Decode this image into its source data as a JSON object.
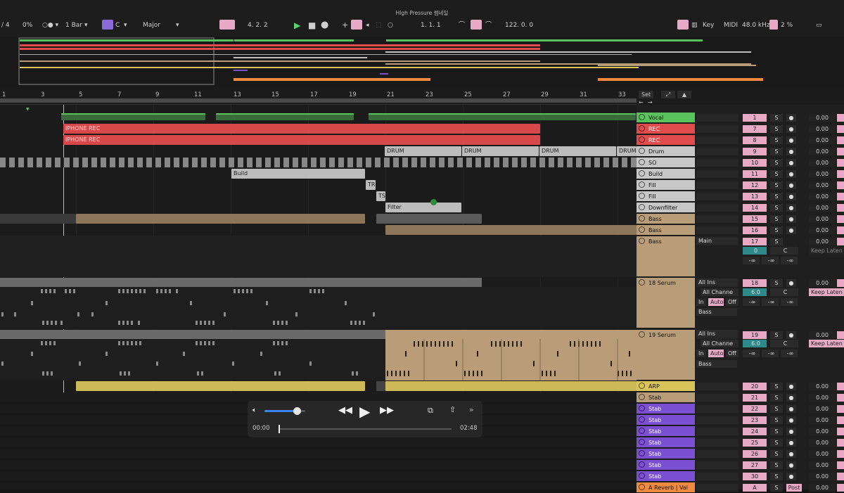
{
  "window": {
    "title": "High Pressure 썸네일"
  },
  "toolbar": {
    "time_sig": "/ 4",
    "cpu": "0%",
    "quantize": "1 Bar",
    "scale_root": "C",
    "scale_mode": "Major",
    "position": "4.  2.  2",
    "loop_start": "1.  1.  1",
    "tempo": "122.  0.  0",
    "key_label": "Key",
    "midi_label": "MIDI",
    "sample_rate": "48.0 kHz",
    "cpu_load": "2 %"
  },
  "ruler": {
    "bars": [
      "1",
      "3",
      "5",
      "7",
      "9",
      "11",
      "13",
      "15",
      "17",
      "19",
      "21",
      "23",
      "25",
      "27",
      "29",
      "31",
      "33"
    ]
  },
  "set_label": "Set",
  "clips": {
    "rec1": "IPHONE REC",
    "rec2": "IPHONE REC",
    "drum1": "DRUM",
    "drum2": "DRUM",
    "drum3": "DRUM",
    "drum4": "DRUM",
    "build": "Build",
    "tr": "TR",
    "ts": "TS",
    "filter": "Filter"
  },
  "tracks": [
    {
      "name": "Vocal",
      "num": "1",
      "color": "#59c25a"
    },
    {
      "name": "REC",
      "num": "7",
      "color": "#e04b4b"
    },
    {
      "name": "REC",
      "num": "8",
      "color": "#e04b4b"
    },
    {
      "name": "Drum",
      "num": "9",
      "color": "#c7c7c7"
    },
    {
      "name": "SO",
      "num": "10",
      "color": "#c7c7c7"
    },
    {
      "name": "Build",
      "num": "11",
      "color": "#c7c7c7"
    },
    {
      "name": "Fill",
      "num": "12",
      "color": "#c7c7c7"
    },
    {
      "name": "Fill",
      "num": "13",
      "color": "#c7c7c7"
    },
    {
      "name": "Downfilter",
      "num": "14",
      "color": "#c7c7c7"
    },
    {
      "name": "Bass",
      "num": "15",
      "color": "#b89d78"
    },
    {
      "name": "Bass",
      "num": "16",
      "color": "#b89d78"
    },
    {
      "name": "Bass",
      "num": "17",
      "color": "#b89d78"
    },
    {
      "name": "18 Serum",
      "num": "18",
      "color": "#b89d78"
    },
    {
      "name": "19 Serum",
      "num": "19",
      "color": "#b89d78"
    },
    {
      "name": "ARP",
      "num": "20",
      "color": "#d9c45a"
    },
    {
      "name": "Stab",
      "num": "21",
      "color": "#b89d78"
    },
    {
      "name": "Stab",
      "num": "22",
      "color": "#7a4fd1"
    },
    {
      "name": "Stab",
      "num": "23",
      "color": "#7a4fd1"
    },
    {
      "name": "Stab",
      "num": "24",
      "color": "#7a4fd1"
    },
    {
      "name": "Stab",
      "num": "25",
      "color": "#7a4fd1"
    },
    {
      "name": "Stab",
      "num": "26",
      "color": "#7a4fd1"
    },
    {
      "name": "Stab",
      "num": "27",
      "color": "#7a4fd1"
    },
    {
      "name": "Stab",
      "num": "30",
      "color": "#7a4fd1"
    },
    {
      "name": "A Reverb | Val",
      "num": "A",
      "color": "#f08a3e"
    }
  ],
  "mixer": {
    "solo": "S",
    "volume": "0.00",
    "post": "Post",
    "bass17_route": "Main",
    "bass17_pan": "0",
    "bass17_center": "C",
    "inf": "-∞",
    "keep_latency": "Keep Laten",
    "serum18_in": "All Ins",
    "serum18_ch": "All Channe",
    "serum18_pan": "6.0",
    "serum19_in": "All Ins",
    "serum19_ch": "All Channe",
    "serum19_pan": "6.0",
    "mon_in": "In",
    "mon_auto": "Auto",
    "mon_off": "Off",
    "route_bass": "Bass"
  },
  "player": {
    "elapsed": "00:00",
    "duration": "02:48",
    "volume": 0.8,
    "progress": 0.0
  }
}
